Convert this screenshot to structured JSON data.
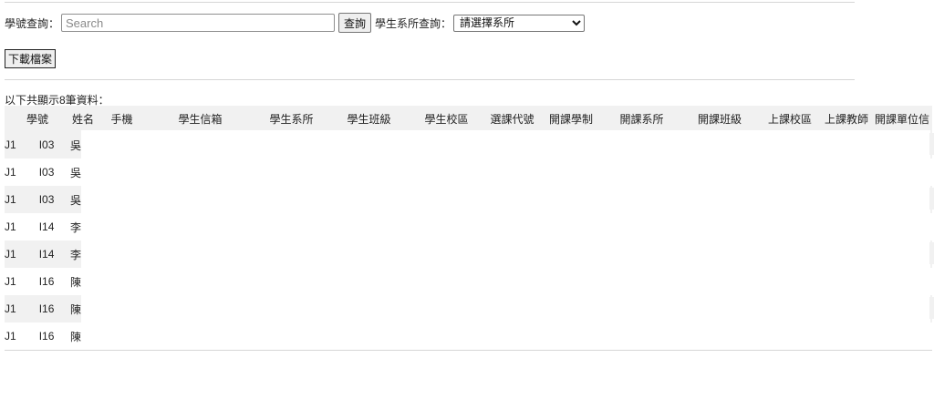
{
  "search": {
    "label": "學號查詢：",
    "placeholder": "Search",
    "query_button": "查詢",
    "dept_label": "學生系所查詢：",
    "dept_selected": "請選擇系所"
  },
  "download_button": "下載檔案",
  "result_count_text": "以下共顯示8筆資料：",
  "table": {
    "headers": [
      "學號",
      "姓名",
      "手機",
      "學生信箱",
      "學生系所",
      "學生班級",
      "學生校區",
      "選課代號",
      "開課學制",
      "開課系所",
      "開課班級",
      "上課校區",
      "上課教師",
      "開課單位信"
    ],
    "rows": [
      {
        "id_prefix": "J1",
        "id_suffix": "I03",
        "name": "吳"
      },
      {
        "id_prefix": "J1",
        "id_suffix": "I03",
        "name": "吳"
      },
      {
        "id_prefix": "J1",
        "id_suffix": "I03",
        "name": "吳"
      },
      {
        "id_prefix": "J1",
        "id_suffix": "I14",
        "name": "李"
      },
      {
        "id_prefix": "J1",
        "id_suffix": "I14",
        "name": "李"
      },
      {
        "id_prefix": "J1",
        "id_suffix": "I16",
        "name": "陳"
      },
      {
        "id_prefix": "J1",
        "id_suffix": "I16",
        "name": "陳"
      },
      {
        "id_prefix": "J1",
        "id_suffix": "I16",
        "name": "陳"
      }
    ]
  }
}
